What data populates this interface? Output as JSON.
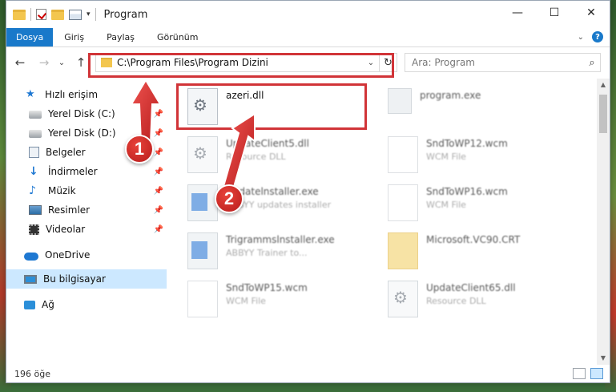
{
  "window": {
    "title": "Program",
    "controls": {
      "minimize": "—",
      "maximize": "☐",
      "close": "✕"
    }
  },
  "ribbon": {
    "tabs": [
      "Dosya",
      "Giriş",
      "Paylaş",
      "Görünüm"
    ]
  },
  "address": {
    "path": "C:\\Program Files\\Program Dizini"
  },
  "search": {
    "placeholder": "Ara: Program"
  },
  "sidebar": {
    "quick_access": "Hızlı erişim",
    "items": [
      {
        "label": "Yerel Disk (C:)",
        "icon": "disk-icon"
      },
      {
        "label": "Yerel Disk (D:)",
        "icon": "disk-icon"
      },
      {
        "label": "Belgeler",
        "icon": "documents-icon"
      },
      {
        "label": "İndirmeler",
        "icon": "downloads-icon"
      },
      {
        "label": "Müzik",
        "icon": "music-icon"
      },
      {
        "label": "Resimler",
        "icon": "pictures-icon"
      },
      {
        "label": "Videolar",
        "icon": "videos-icon"
      }
    ],
    "onedrive": "OneDrive",
    "this_pc": "Bu bilgisayar",
    "network": "Ağ"
  },
  "files": [
    {
      "name": "azeri.dll",
      "type": "",
      "icon": "dll-icon"
    },
    {
      "name": "program.exe",
      "type": "",
      "icon": "exe-icon"
    },
    {
      "name": "UpdateClient5.dll",
      "type": "Resource DLL",
      "icon": "dll-icon"
    },
    {
      "name": "SndToWP12.wcm",
      "type": "WCM File",
      "icon": "wcm-icon"
    },
    {
      "name": "Updatelnstaller.exe",
      "type": "ABBYY updates installer",
      "icon": "exe-icon"
    },
    {
      "name": "SndToWP16.wcm",
      "type": "WCM File",
      "icon": "wcm-icon"
    },
    {
      "name": "Trigrammslnstaller.exe",
      "type": "ABBYY Trainer to...",
      "icon": "exe-icon"
    },
    {
      "name": "Microsoft.VC90.CRT",
      "type": "",
      "icon": "folder-icon"
    },
    {
      "name": "SndToWP15.wcm",
      "type": "WCM File",
      "icon": "wcm-icon"
    },
    {
      "name": "UpdateClient65.dll",
      "type": "Resource DLL",
      "icon": "dll-icon"
    }
  ],
  "status": {
    "count": "196 öğe"
  },
  "callouts": [
    "1",
    "2"
  ],
  "colors": {
    "accent": "#1979ca",
    "highlight": "#d13438",
    "selection": "#cce8ff"
  }
}
